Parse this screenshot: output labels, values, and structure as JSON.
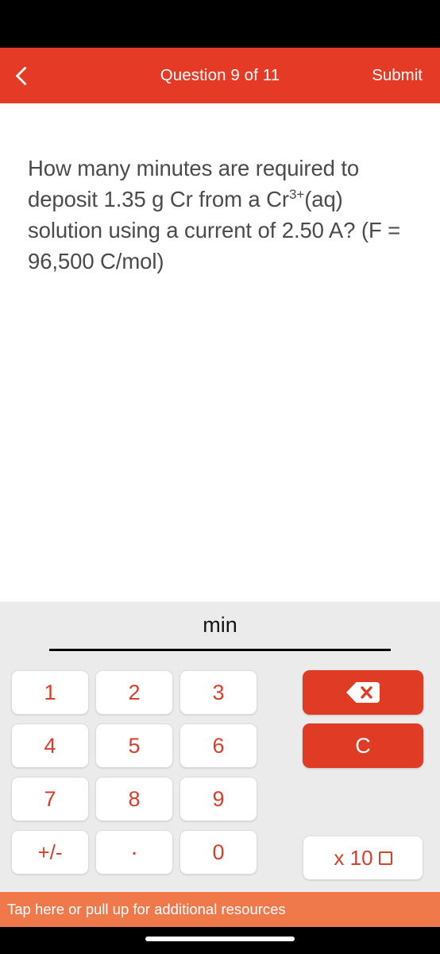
{
  "colors": {
    "header_red": "#E43A26",
    "key_red": "#D6402A",
    "action_red": "#DF3B25",
    "resources_orange": "#F0794B",
    "panel_gray": "#EBEBEB",
    "question_text": "#4B4B4B"
  },
  "header": {
    "back_icon": "chevron-left-icon",
    "title": "Question 9 of 11",
    "submit_label": "Submit"
  },
  "question": {
    "line1": "How many minutes are required to",
    "line2_a": "deposit 1.35 g Cr from a Cr",
    "line2_sup": "3+",
    "line2_b": "(aq)",
    "line3": "solution using a current of 2.50 A?",
    "line4": "(F = 96,500 C/mol)"
  },
  "answer": {
    "unit": "min",
    "value": ""
  },
  "keypad": {
    "keys": [
      {
        "label": "1",
        "name": "key-1"
      },
      {
        "label": "2",
        "name": "key-2"
      },
      {
        "label": "3",
        "name": "key-3"
      },
      {
        "label": "4",
        "name": "key-4"
      },
      {
        "label": "5",
        "name": "key-5"
      },
      {
        "label": "6",
        "name": "key-6"
      },
      {
        "label": "7",
        "name": "key-7"
      },
      {
        "label": "8",
        "name": "key-8"
      },
      {
        "label": "9",
        "name": "key-9"
      },
      {
        "label": "+/-",
        "name": "key-sign"
      },
      {
        "label": ".",
        "name": "key-decimal"
      },
      {
        "label": "0",
        "name": "key-0"
      }
    ]
  },
  "actions": {
    "backspace_icon": "backspace-icon",
    "clear_label": "C",
    "exponent_label": "x 10"
  },
  "resources": {
    "label": "Tap here or pull up for additional resources"
  }
}
